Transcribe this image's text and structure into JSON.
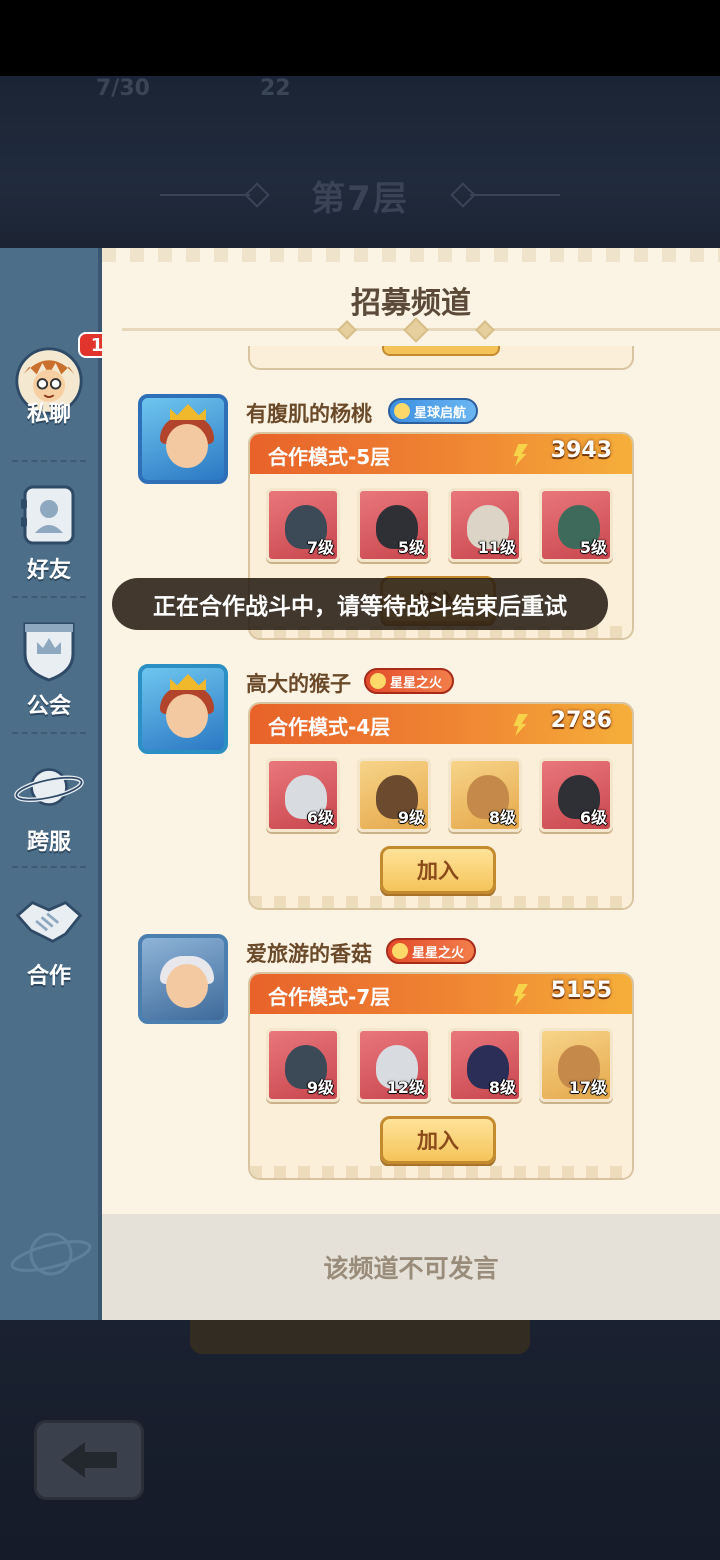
{
  "background": {
    "stat_left": "7/30",
    "stat_right": "22",
    "floor_title": "第7层"
  },
  "sidebar": {
    "items": [
      {
        "label": "私聊",
        "icon": "avatar-chat-icon",
        "badge": "1"
      },
      {
        "label": "好友",
        "icon": "friends-icon"
      },
      {
        "label": "公会",
        "icon": "guild-shield-icon"
      },
      {
        "label": "跨服",
        "icon": "planet-icon"
      },
      {
        "label": "合作",
        "icon": "handshake-icon"
      }
    ]
  },
  "channel": {
    "title": "招募频道",
    "footer_notice": "该频道不可发言",
    "toast": "正在合作战斗中，请等待战斗结束后重试"
  },
  "messages": [
    {
      "username": "有腹肌的杨桃",
      "tag": "星球启航",
      "tag_color": "#3b8fe0",
      "mode": "合作模式-5层",
      "power": "3943",
      "heroes": [
        {
          "level": "7级",
          "bg": "red",
          "color": "#3c4a58"
        },
        {
          "level": "5级",
          "bg": "red",
          "color": "#2f2f36"
        },
        {
          "level": "11级",
          "bg": "red",
          "color": "#dcd4c6"
        },
        {
          "level": "5级",
          "bg": "red",
          "color": "#3e6a5c"
        }
      ],
      "join_label": "加入"
    },
    {
      "username": "高大的猴子",
      "tag": "星星之火",
      "tag_color": "#e34b2a",
      "mode": "合作模式-4层",
      "power": "2786",
      "heroes": [
        {
          "level": "6级",
          "bg": "red",
          "color": "#d8dbe0"
        },
        {
          "level": "9级",
          "bg": "gold",
          "color": "#6b4a2e"
        },
        {
          "level": "8级",
          "bg": "gold",
          "color": "#c58a4a"
        },
        {
          "level": "6级",
          "bg": "red",
          "color": "#2f2f36"
        }
      ],
      "join_label": "加入"
    },
    {
      "username": "爱旅游的香菇",
      "tag": "星星之火",
      "tag_color": "#e34b2a",
      "mode": "合作模式-7层",
      "power": "5155",
      "heroes": [
        {
          "level": "9级",
          "bg": "red",
          "color": "#3c4a58"
        },
        {
          "level": "12级",
          "bg": "red",
          "color": "#d8dbe0"
        },
        {
          "level": "8级",
          "bg": "red",
          "color": "#2b2f58"
        },
        {
          "level": "17级",
          "bg": "gold",
          "color": "#c58a4a"
        }
      ],
      "join_label": "加入"
    }
  ],
  "colors": {
    "sidebar": "#4c6e88",
    "panel_bg": "#fbf3e4",
    "card_header": "#e8622a",
    "join_button": "#f4c45a"
  }
}
